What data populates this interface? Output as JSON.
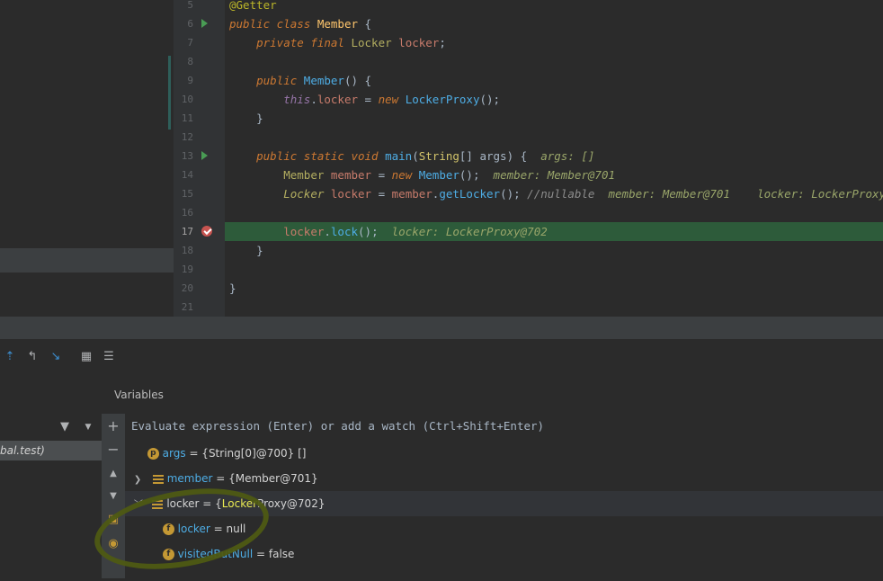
{
  "editor": {
    "line_numbers": [
      "5",
      "6",
      "7",
      "8",
      "9",
      "10",
      "11",
      "12",
      "13",
      "14",
      "15",
      "16",
      "17",
      "18",
      "19",
      "20",
      "21"
    ],
    "current_line": "17"
  },
  "debug": {
    "variables_title": "Variables",
    "eval_placeholder": "Evaluate expression (Enter) or add a watch (Ctrl+Shift+Enter)",
    "frame_selected": "bal.test)",
    "variables": [
      {
        "badge": "p",
        "name": "args",
        "value": "= {String[0]@700} []"
      },
      {
        "name": "member",
        "value": "= {Member@701}"
      },
      {
        "name": "locker",
        "value_pre": "= {",
        "value_yellow": "Locker",
        "value_post": "Proxy@702}"
      },
      {
        "badge": "f",
        "name": "locker",
        "value": "= null"
      },
      {
        "badge": "f",
        "name": "visitedButNull",
        "value": "= false"
      }
    ]
  },
  "colors": {
    "current_line_bg": "#2d5b3a",
    "annotation_circle": "#4e5a13"
  }
}
